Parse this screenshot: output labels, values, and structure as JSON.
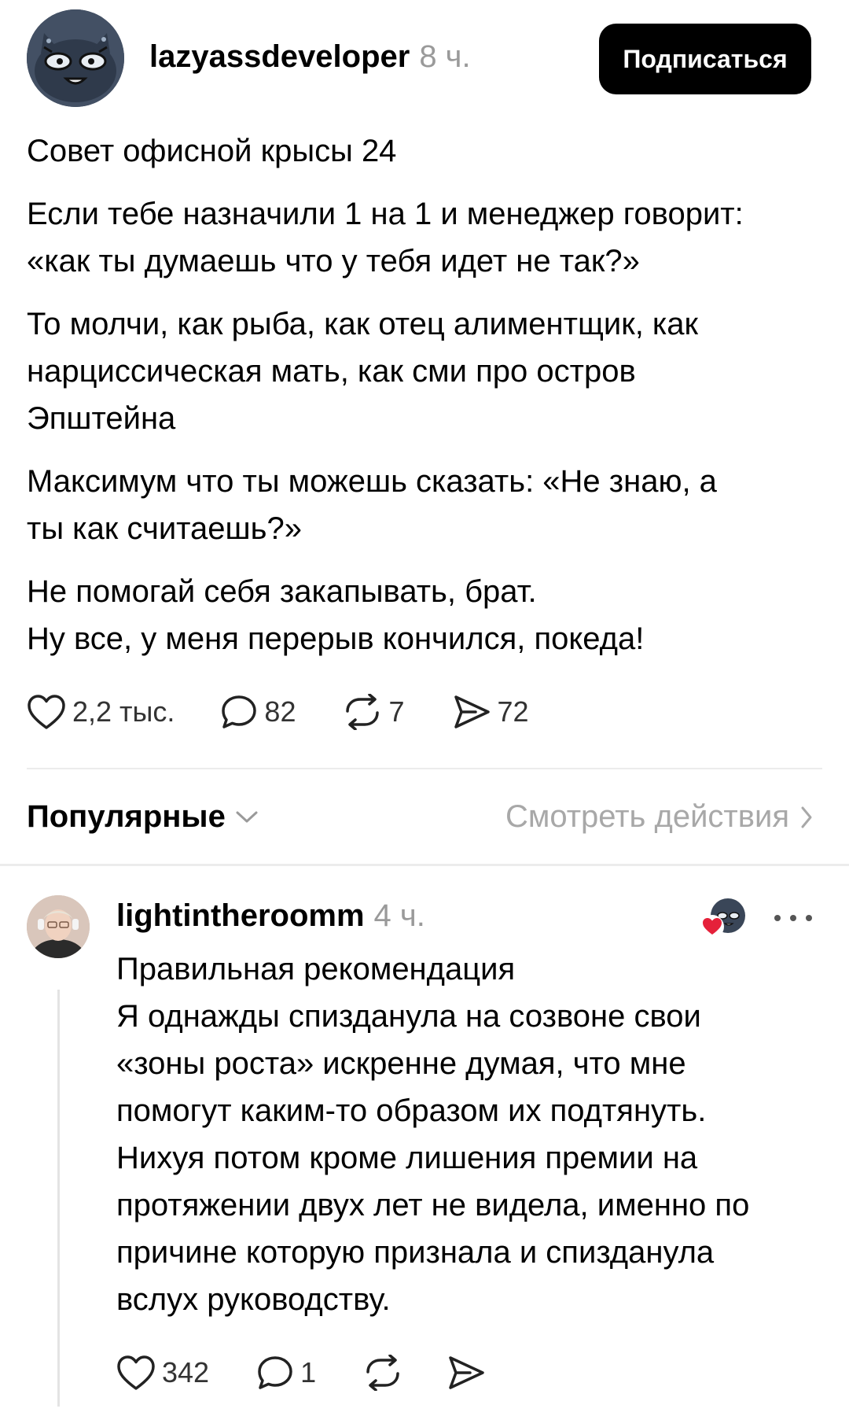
{
  "post": {
    "username": "lazyassdeveloper",
    "time": "8 ч.",
    "follow_label": "Подписаться",
    "paragraphs": [
      [
        "Совет офисной крысы 24"
      ],
      [
        "Если тебе назначили 1 на 1 и менеджер говорит:",
        "«как ты думаешь что у тебя идет не так?»"
      ],
      [
        "То молчи, как рыба, как отец алиментщик, как",
        "нарциссическая мать, как сми про остров",
        "Эпштейна"
      ],
      [
        "Максимум что ты можешь сказать: «Не знаю, а",
        "ты как считаешь?»"
      ],
      [
        "Не помогай себя закапывать, брат.",
        "Ну все, у меня перерыв кончился, покеда!"
      ]
    ],
    "stats": {
      "likes": "2,2 тыс.",
      "comments": "82",
      "reposts": "7",
      "shares": "72"
    }
  },
  "sort": {
    "label": "Популярные",
    "activity_label": "Смотреть действия"
  },
  "reply": {
    "username": "lightintheroomm",
    "time": "4 ч.",
    "lines": [
      "Правильная рекомендация",
      "Я однажды спизданула на созвоне свои",
      "«зоны роста» искренне думая, что мне",
      "помогут каким-то образом их подтянуть.",
      "Нихуя потом кроме лишения премии на",
      "протяжении двух лет не видела, именно по",
      "причине которую признала и спизданула",
      "вслух руководству."
    ],
    "stats": {
      "likes": "342",
      "comments": "1"
    }
  },
  "colors": {
    "text": "#000000",
    "muted": "#9a9a9a",
    "button_bg": "#000000",
    "button_text": "#ffffff",
    "heart_red": "#e5213a",
    "divider": "#ececec"
  },
  "icons": [
    "heart-icon",
    "comment-icon",
    "repost-icon",
    "share-icon",
    "chevron-down-icon",
    "chevron-right-icon",
    "more-icon"
  ]
}
